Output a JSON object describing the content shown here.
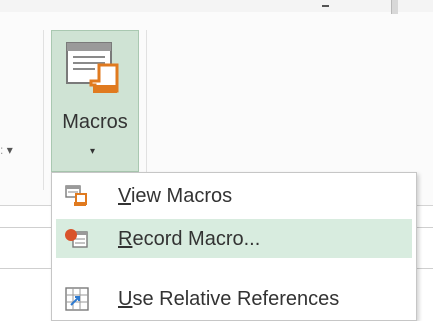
{
  "ribbon": {
    "left_caret": "▾",
    "macros_button": {
      "label": "Macros",
      "caret": "▾"
    }
  },
  "menu": {
    "items": [
      {
        "accel": "V",
        "rest": "iew Macros",
        "icon": "view-macros-icon",
        "highlighted": false
      },
      {
        "accel": "R",
        "rest": "ecord Macro...",
        "icon": "record-macro-icon",
        "highlighted": true
      },
      {
        "accel": "U",
        "rest": "se Relative References",
        "icon": "relative-references-icon",
        "highlighted": false
      }
    ]
  },
  "colors": {
    "accent_green": "#cfe3d4",
    "highlight": "#d8ecdf",
    "record_dot": "#d9532b",
    "macro_orange": "#e07a1f"
  }
}
